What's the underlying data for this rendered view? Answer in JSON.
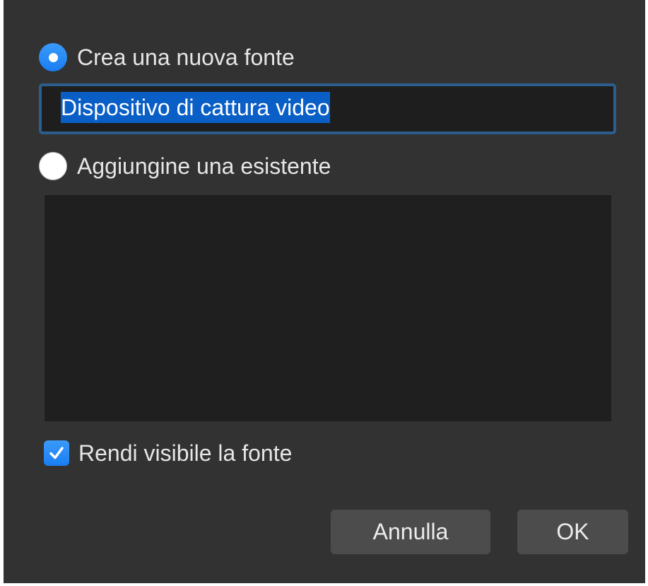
{
  "dialog": {
    "option_new": {
      "label": "Crea una nuova fonte",
      "selected": true
    },
    "name_input": {
      "value": "Dispositivo di cattura video",
      "text_selected": true
    },
    "option_existing": {
      "label": "Aggiungine una esistente",
      "selected": false
    },
    "existing_sources": [],
    "visible_checkbox": {
      "label": "Rendi visibile la fonte",
      "checked": true
    },
    "buttons": {
      "cancel_label": "Annulla",
      "ok_label": "OK"
    }
  },
  "colors": {
    "background": "#323232",
    "accent": "#1a7ef2",
    "selection": "#0a5fc7",
    "text": "#e6e6e6",
    "field_background": "#1e1e1e",
    "button_background": "#4c4c4c"
  },
  "icons": {
    "radio_selected": "radio-selected-icon",
    "radio_unselected": "radio-unselected-icon",
    "checkbox_checked": "checkmark-icon"
  }
}
